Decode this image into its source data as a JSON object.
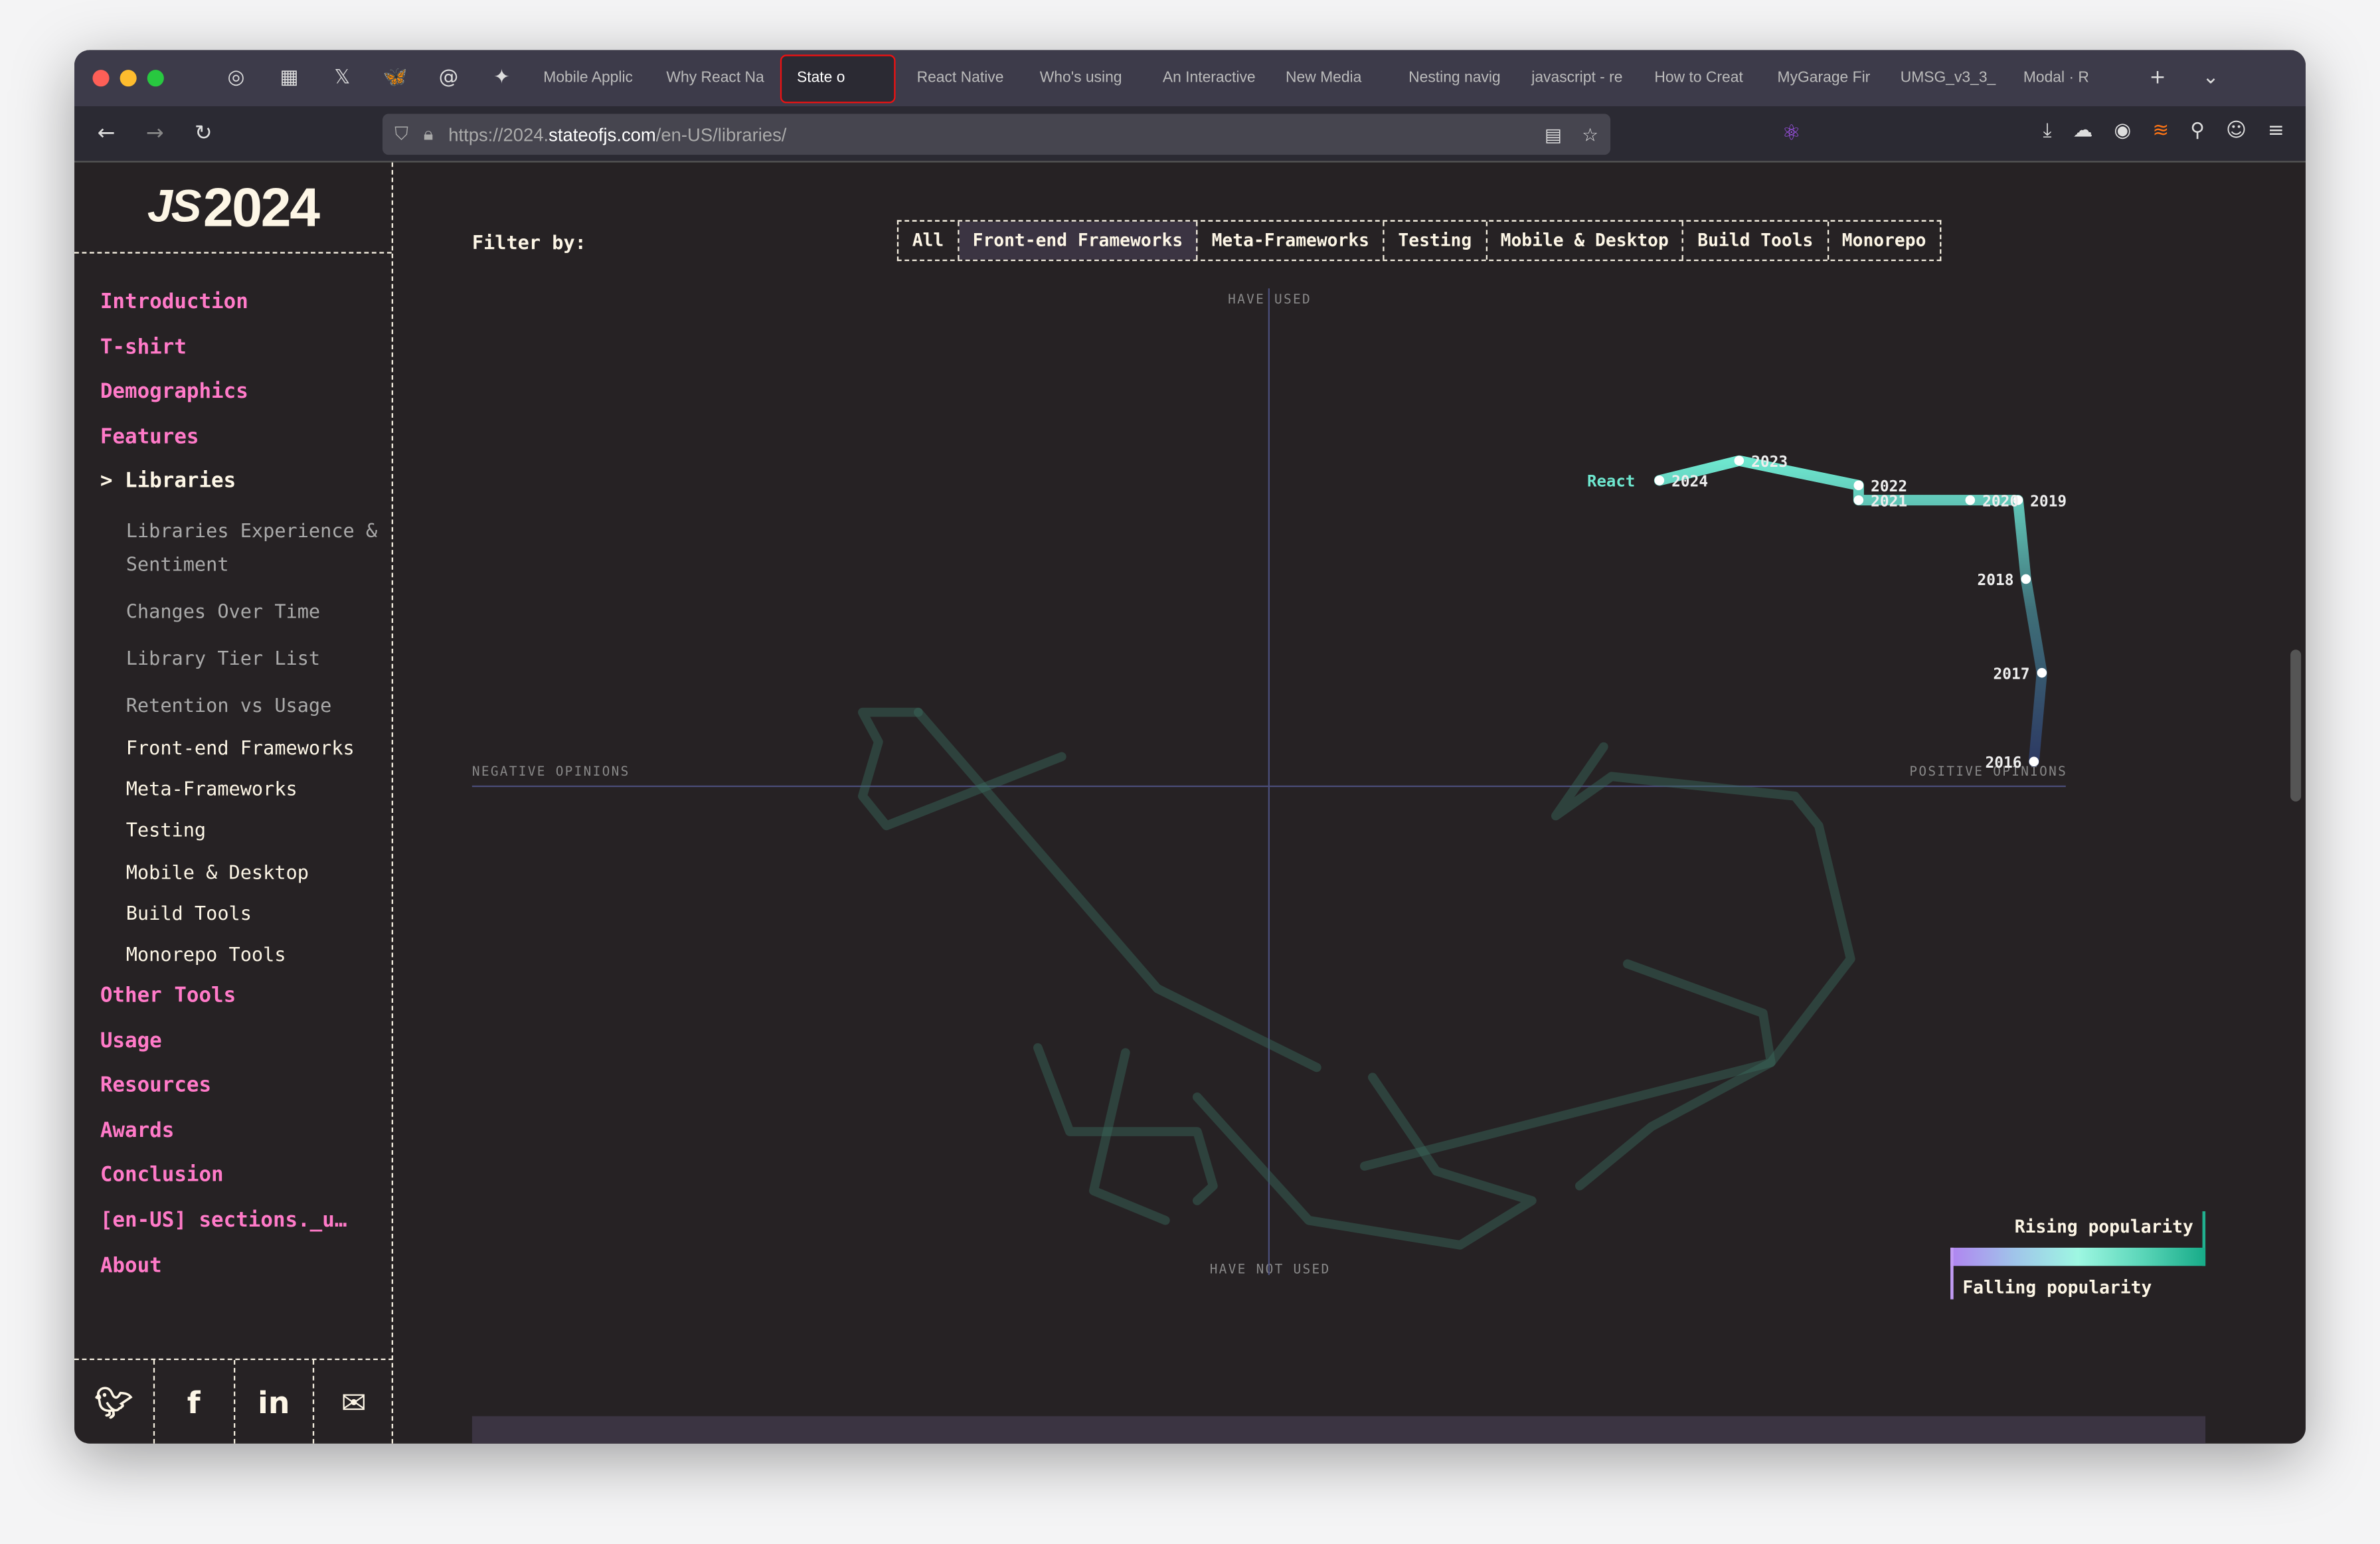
{
  "browser": {
    "pinned_tabs": [
      {
        "icon": "openai-icon"
      },
      {
        "icon": "clapper-icon"
      },
      {
        "icon": "x-icon"
      },
      {
        "icon": "bluesky-icon"
      },
      {
        "icon": "threads-icon"
      },
      {
        "icon": "pin-icon"
      }
    ],
    "tabs": [
      "Mobile Applic",
      "Why React Na",
      "State o",
      "React Native",
      "Who's using",
      "An Interactive",
      "New Media",
      "Nesting navig",
      "javascript - re",
      "How to Creat",
      "MyGarage Fir",
      "UMSG_v3_3_",
      "Modal · R"
    ],
    "active_tab_index": 2,
    "url_prefix": "https://2024.",
    "url_domain": "stateofjs.com",
    "url_path": "/en-US/libraries/"
  },
  "sidebar": {
    "logo": "2024",
    "items": [
      {
        "label": "Introduction"
      },
      {
        "label": "T-shirt"
      },
      {
        "label": "Demographics"
      },
      {
        "label": "Features"
      },
      {
        "label": "> Libraries"
      }
    ],
    "sub_items": [
      "Libraries Experience & Sentiment",
      "Changes Over Time",
      "Library Tier List",
      "Retention vs Usage"
    ],
    "sub_items2": [
      "Front-end Frameworks",
      "Meta-Frameworks",
      "Testing",
      "Mobile & Desktop",
      "Build Tools",
      "Monorepo Tools"
    ],
    "items_after": [
      "Other Tools",
      "Usage",
      "Resources",
      "Awards",
      "Conclusion",
      "[en-US] sections._u…",
      "About"
    ],
    "social": [
      "twitter-icon",
      "facebook-icon",
      "linkedin-icon",
      "mail-icon"
    ]
  },
  "filter": {
    "label": "Filter by:",
    "options": [
      "All",
      "Front-end Frameworks",
      "Meta-Frameworks",
      "Testing",
      "Mobile & Desktop",
      "Build Tools",
      "Monorepo"
    ],
    "selected": "Front-end Frameworks"
  },
  "chart_data": {
    "type": "line",
    "axes": {
      "top": "HAVE USED",
      "bottom": "HAVE NOT USED",
      "left": "NEGATIVE OPINIONS",
      "right": "POSITIVE OPINIONS"
    },
    "xlim": [
      -1,
      1
    ],
    "ylim": [
      -1,
      1
    ],
    "grid": false,
    "highlight": {
      "name": "React",
      "color": "#6ee7cf",
      "points": [
        {
          "year": "2016",
          "x": 0.96,
          "y": 0.05
        },
        {
          "year": "2017",
          "x": 0.97,
          "y": 0.23
        },
        {
          "year": "2018",
          "x": 0.95,
          "y": 0.42
        },
        {
          "year": "2019",
          "x": 0.94,
          "y": 0.58
        },
        {
          "year": "2020",
          "x": 0.88,
          "y": 0.58
        },
        {
          "year": "2021",
          "x": 0.74,
          "y": 0.58
        },
        {
          "year": "2022",
          "x": 0.74,
          "y": 0.61
        },
        {
          "year": "2023",
          "x": 0.59,
          "y": 0.66
        },
        {
          "year": "2024",
          "x": 0.49,
          "y": 0.62
        }
      ]
    },
    "background_series": [
      [
        [
          -0.44,
          0.15
        ],
        [
          -0.51,
          0.15
        ],
        [
          -0.49,
          0.09
        ],
        [
          -0.51,
          -0.02
        ],
        [
          -0.48,
          -0.08
        ],
        [
          -0.26,
          0.06
        ]
      ],
      [
        [
          -0.44,
          0.15
        ],
        [
          -0.14,
          -0.41
        ],
        [
          0.06,
          -0.57
        ]
      ],
      [
        [
          0.42,
          0.08
        ],
        [
          0.36,
          -0.06
        ],
        [
          0.43,
          0.02
        ],
        [
          0.66,
          -0.02
        ],
        [
          0.69,
          -0.08
        ],
        [
          0.73,
          -0.35
        ],
        [
          0.63,
          -0.56
        ],
        [
          0.48,
          -0.69
        ],
        [
          0.39,
          -0.81
        ]
      ],
      [
        [
          0.45,
          -0.36
        ],
        [
          0.62,
          -0.46
        ],
        [
          0.63,
          -0.56
        ],
        [
          0.12,
          -0.77
        ]
      ],
      [
        [
          -0.29,
          -0.53
        ],
        [
          -0.25,
          -0.7
        ],
        [
          -0.09,
          -0.7
        ],
        [
          -0.07,
          -0.81
        ],
        [
          -0.09,
          -0.84
        ]
      ],
      [
        [
          0.13,
          -0.59
        ],
        [
          0.21,
          -0.78
        ],
        [
          0.33,
          -0.84
        ],
        [
          0.24,
          -0.93
        ],
        [
          0.05,
          -0.88
        ],
        [
          -0.09,
          -0.63
        ]
      ],
      [
        [
          -0.18,
          -0.54
        ],
        [
          -0.22,
          -0.82
        ],
        [
          -0.13,
          -0.88
        ]
      ]
    ],
    "legend": {
      "rising": "Rising popularity",
      "falling": "Falling popularity",
      "colors": [
        "#b084f0",
        "#9ef7e2",
        "#17ab88"
      ]
    }
  }
}
